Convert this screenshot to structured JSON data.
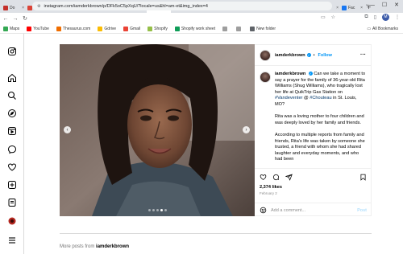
{
  "browser": {
    "tabs": [
      {
        "label": "Do",
        "color": "#c4302b"
      },
      {
        "label": "Ge",
        "color": "#db4437"
      },
      {
        "label": "Ge",
        "color": "#db4437"
      },
      {
        "label": "Rita",
        "color": "#4a4a4a"
      },
      {
        "label": "Rita",
        "color": "#4285f4"
      },
      {
        "label": "Fac",
        "color": "#1877f2"
      },
      {
        "label": "",
        "color": "#e1306c",
        "active": true
      },
      {
        "label": "Rita",
        "color": "#4a4a4a"
      },
      {
        "label": "Rita",
        "color": "#4a4a4a"
      },
      {
        "label": "hy",
        "color": "#4285f4"
      },
      {
        "label": "RIV",
        "color": "#4a4a4a"
      },
      {
        "label": "Wo",
        "color": "#b71c1c"
      },
      {
        "label": "Fac",
        "color": "#1877f2"
      },
      {
        "label": "mo",
        "color": "#ff9800"
      },
      {
        "label": "Fac",
        "color": "#1877f2"
      }
    ],
    "new_tab": "+",
    "window_controls": [
      "—",
      "☐",
      "✕"
    ],
    "url": "instagram.com/iamderkbrown/p/DFk5oC5pXqU/?locale=us&hl=am-et&img_index=4",
    "profile_initial": "M"
  },
  "bookmarks": {
    "items": [
      {
        "label": "Maps",
        "color": "#34a853"
      },
      {
        "label": "YouTube",
        "color": "#ff0000"
      },
      {
        "label": "Thesaurus.com",
        "color": "#f06d00"
      },
      {
        "label": "Gdrive",
        "color": "#fbbc04"
      },
      {
        "label": "Gmail",
        "color": "#ea4335"
      },
      {
        "label": "Shopify",
        "color": "#95bf47"
      },
      {
        "label": "Shopify work sheet",
        "color": "#0f9d58"
      },
      {
        "label": "",
        "color": "#9e9e9e"
      },
      {
        "label": "",
        "color": "#9e9e9e"
      },
      {
        "label": "New folder",
        "color": "#5f6368"
      }
    ],
    "all_bookmarks": "All Bookmarks"
  },
  "post": {
    "username": "iamderkbrown",
    "follow": "Follow",
    "caption": [
      "Can we take a moment to say a prayer for the family of 36-year-old Rita Williams (Shug Williams), who tragically lost her life at QuikTrip Gas Station on",
      "#Vandeventer",
      "@",
      "#Chouteau",
      "in St. Louis, MO?"
    ],
    "caption_p2": "Rita was a loving mother to four children and was deeply loved by her family and friends.",
    "caption_p3": "According to multiple reports from family and friends, Rita's life was taken by someone she trusted, a friend with whom she had shared laughter and everyday moments, and who had been",
    "likes": "2,374 likes",
    "date": "February 2",
    "comment_placeholder": "Add a comment...",
    "post_button": "Post"
  },
  "more_posts": {
    "prefix": "More posts from",
    "username": "iamderkbrown"
  }
}
